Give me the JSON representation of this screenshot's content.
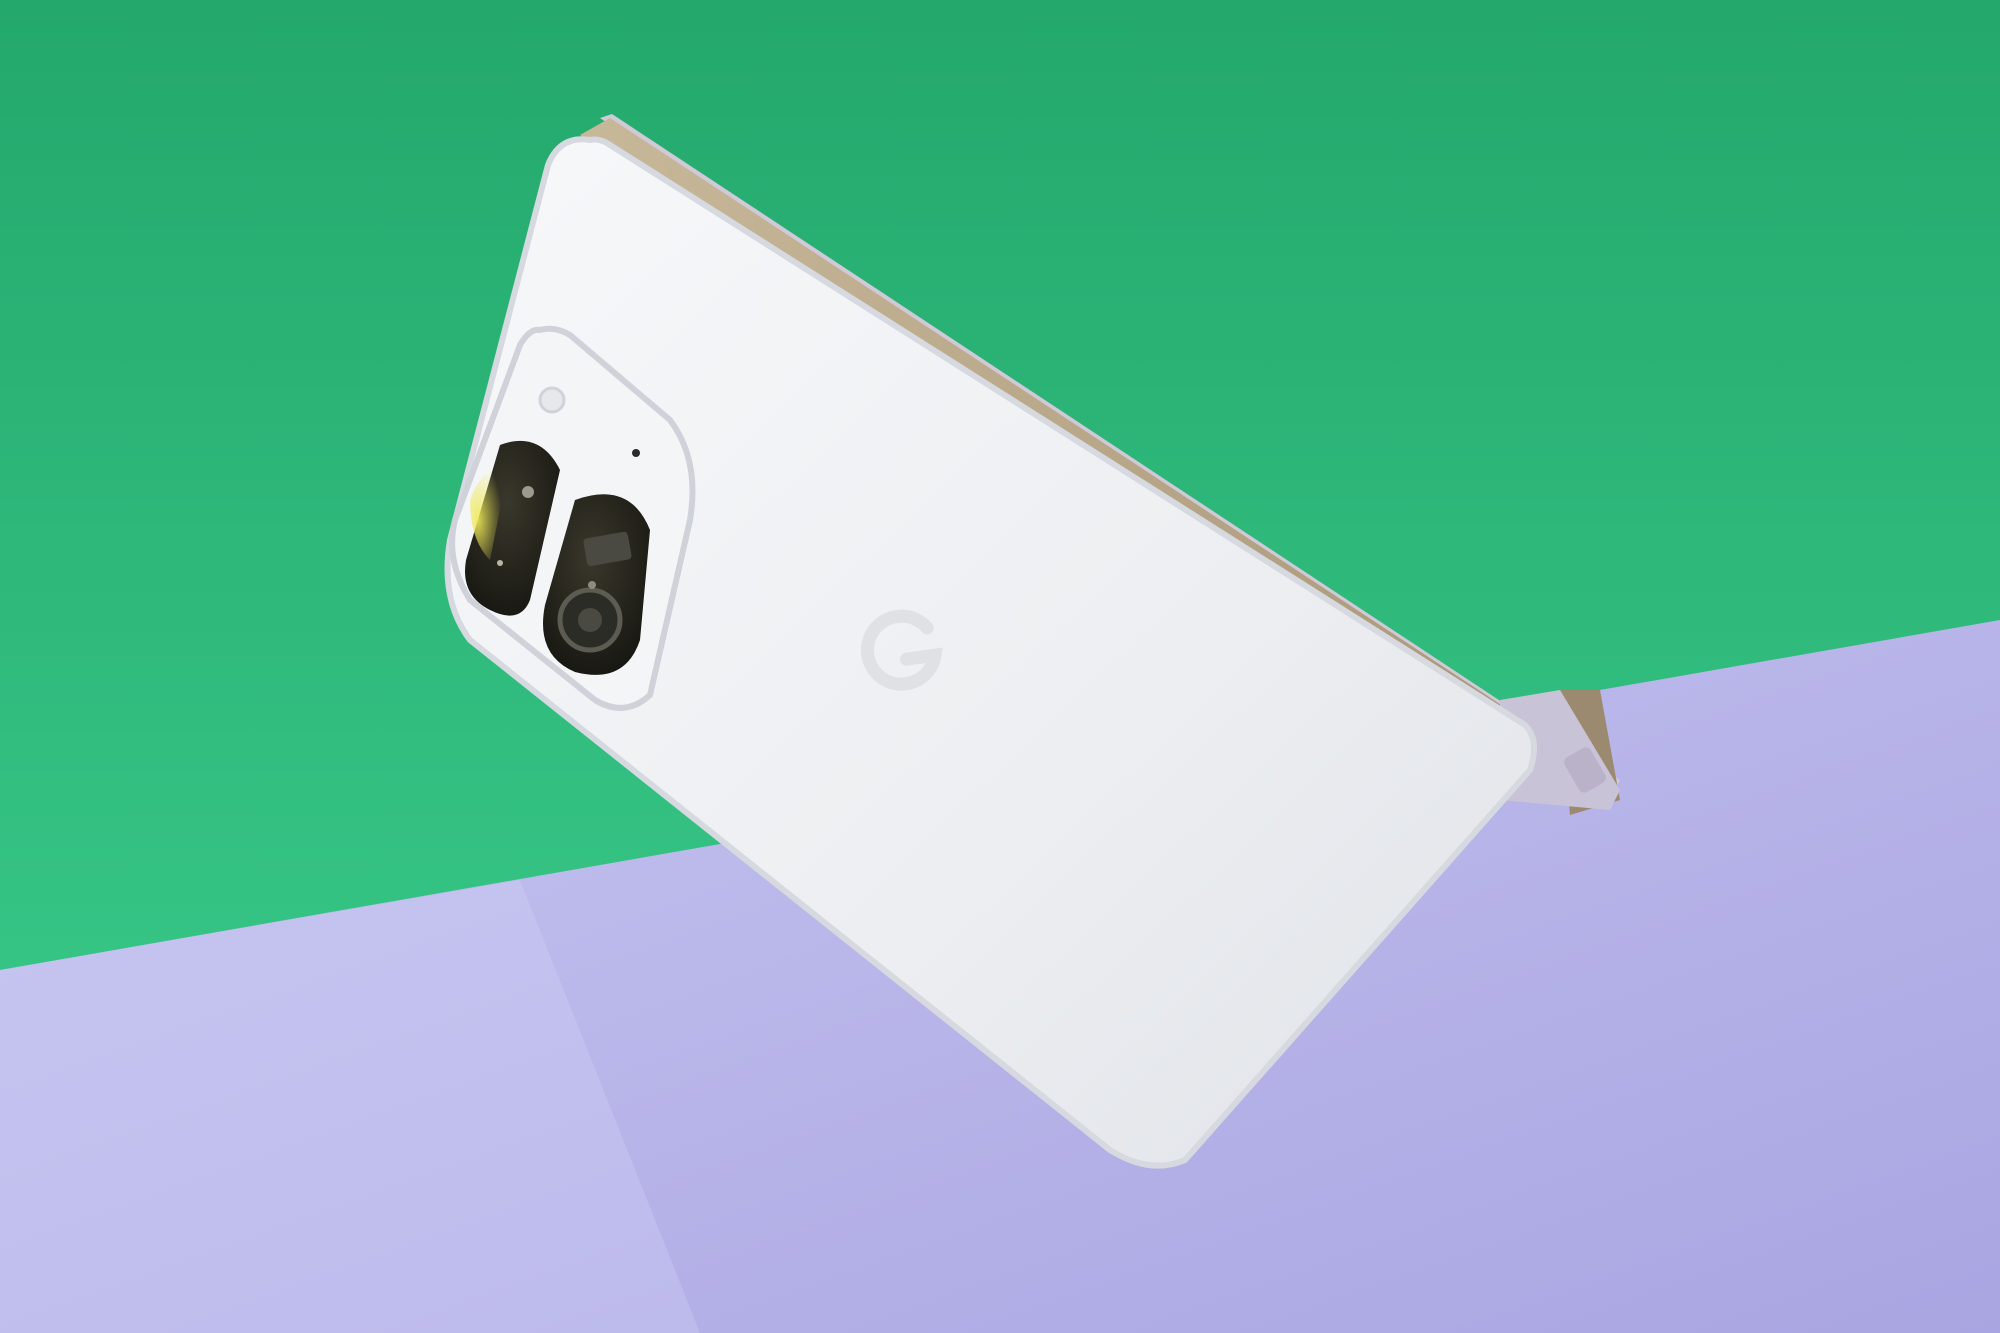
{
  "scene": {
    "subject": "foldable-phone-back",
    "colors": {
      "wall_top": "#24a86c",
      "wall_bottom": "#3ccf8e",
      "table_light": "#c2c0ee",
      "table_dark": "#a7a3e0",
      "phone_body": "#eef0f2",
      "phone_edge": "#d9dbe0",
      "hinge_gold": "#b5a58a",
      "camera_glass": "#202019",
      "lens_glint": "#e8e254",
      "logo": "#dfe1e5"
    },
    "icons": [
      "camera-bar-icon",
      "flash-icon",
      "google-g-logo-icon"
    ]
  }
}
